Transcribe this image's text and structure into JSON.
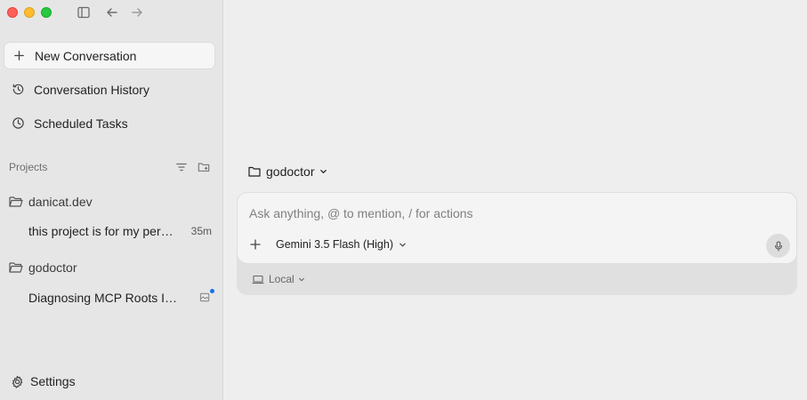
{
  "sidebar": {
    "new_conversation": "New Conversation",
    "conversation_history": "Conversation History",
    "scheduled_tasks": "Scheduled Tasks",
    "projects_label": "Projects",
    "projects": [
      {
        "name": "danicat.dev",
        "conversations": [
          {
            "title": "this project is for my per…",
            "time": "35m"
          }
        ]
      },
      {
        "name": "godoctor",
        "conversations": [
          {
            "title": "Diagnosing MCP Roots Im…",
            "time": ""
          }
        ]
      }
    ],
    "settings": "Settings"
  },
  "main": {
    "project_selector": "godoctor",
    "composer": {
      "placeholder": "Ask anything, @ to mention, / for actions",
      "value": "",
      "model": "Gemini 3.5 Flash (High)",
      "environment": "Local"
    }
  },
  "icons": {
    "traffic_lights": [
      "close",
      "minimize",
      "zoom"
    ],
    "toolbar": [
      "sidebar-toggle-icon",
      "back-arrow-icon",
      "forward-arrow-icon"
    ]
  },
  "colors": {
    "accent_dot": "#1a73e8",
    "sidebar_bg": "#e6e6e6",
    "main_bg": "#eeeeee"
  }
}
